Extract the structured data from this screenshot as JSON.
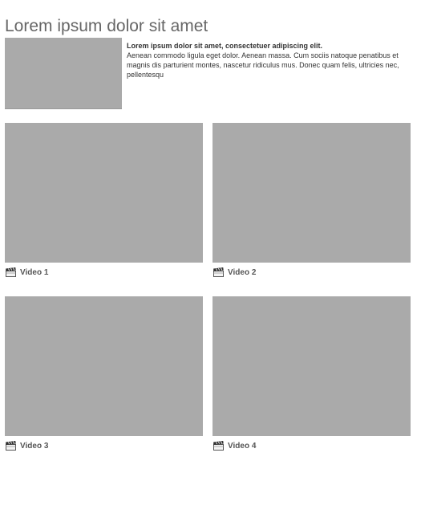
{
  "header": {
    "title": "Lorem ipsum dolor sit amet"
  },
  "intro": {
    "lead": "Lorem ipsum dolor sit amet, consectetuer adipiscing elit.",
    "body": "Aenean commodo ligula eget dolor. Aenean massa. Cum sociis natoque penatibus et magnis dis parturient montes, nascetur ridiculus mus. Donec quam felis, ultricies nec, pellentesqu"
  },
  "videos": [
    {
      "label": "Video 1",
      "icon": "clapperboard-icon"
    },
    {
      "label": "Video 2",
      "icon": "clapperboard-icon"
    },
    {
      "label": "Video 3",
      "icon": "clapperboard-icon"
    },
    {
      "label": "Video 4",
      "icon": "clapperboard-icon"
    }
  ],
  "colors": {
    "placeholder": "#aaaaaa",
    "title": "#666666",
    "text": "#333333"
  }
}
